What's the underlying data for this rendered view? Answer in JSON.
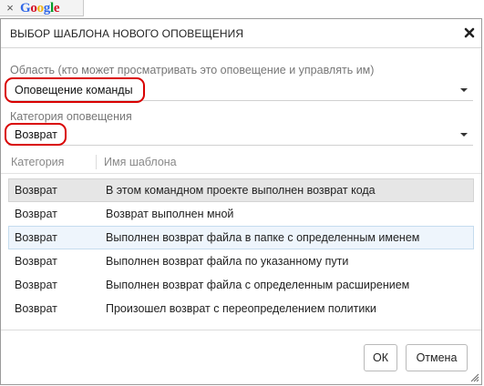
{
  "browser": {
    "tab_close": "×",
    "tab_logo_letters": [
      {
        "ch": "G",
        "color": "#3369e8"
      },
      {
        "ch": "o",
        "color": "#d50f25"
      },
      {
        "ch": "o",
        "color": "#eeb211"
      },
      {
        "ch": "g",
        "color": "#3369e8"
      },
      {
        "ch": "l",
        "color": "#009925"
      },
      {
        "ch": "e",
        "color": "#d50f25"
      }
    ]
  },
  "dialog": {
    "title": "ВЫБОР ШАБЛОНА НОВОГО ОПОВЕЩЕНИЯ",
    "close_icon": "close-x-icon",
    "scope": {
      "label": "Область (кто может просматривать это оповещение и управлять им)",
      "value": "Оповещение команды"
    },
    "category": {
      "label": "Категория оповещения",
      "value": "Возврат"
    },
    "columns": {
      "category": "Категория",
      "template_name": "Имя шаблона"
    },
    "rows": [
      {
        "category": "Возврат",
        "name": "В этом командном проекте выполнен возврат кода",
        "state": "selected"
      },
      {
        "category": "Возврат",
        "name": "Возврат выполнен мной",
        "state": "normal"
      },
      {
        "category": "Возврат",
        "name": "Выполнен возврат файла в папке с определенным именем",
        "state": "hover"
      },
      {
        "category": "Возврат",
        "name": "Выполнен возврат файла по указанному пути",
        "state": "normal"
      },
      {
        "category": "Возврат",
        "name": "Выполнен возврат файла с определенным расширением",
        "state": "normal"
      },
      {
        "category": "Возврат",
        "name": "Произошел возврат с переопределением политики",
        "state": "normal"
      }
    ],
    "buttons": {
      "ok": "ОК",
      "cancel": "Отмена"
    }
  },
  "colors": {
    "annotation_circle": "#d90000",
    "selected_row": "#e6e6e6",
    "hover_row": "#eef5fc"
  }
}
